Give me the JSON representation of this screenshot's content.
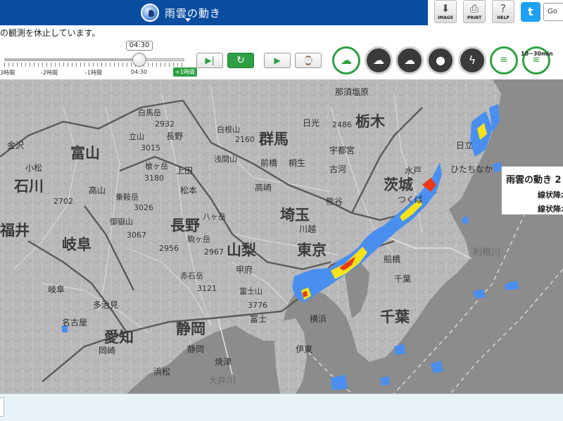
{
  "header": {
    "app_title": "雨雲の動き",
    "buttons": {
      "image": "IMAGE",
      "print": "PRINT",
      "help": "HELP",
      "twitter": "t",
      "google": "Go"
    }
  },
  "notice": "の観測を休止しています。",
  "slider": {
    "current_time": "04:30",
    "tick_labels": [
      "3時間",
      "-2時間",
      "-1時間",
      "04:30"
    ],
    "plus_label": "+1時間",
    "position_fraction": 0.75
  },
  "playback": {
    "step": "▶|",
    "latest": "↻",
    "play": "▶",
    "speed": "⌚"
  },
  "layers": {
    "line_b_label": "10~30min"
  },
  "map": {
    "prefectures": [
      "栃木",
      "群馬",
      "茨城",
      "埼玉",
      "長野",
      "山梨",
      "東京",
      "富山",
      "石川",
      "福井",
      "岐阜",
      "愛知",
      "静岡",
      "千葉"
    ],
    "cities": [
      "那須塩原",
      "日光",
      "宇都宮",
      "前橋",
      "桐生",
      "高崎",
      "水戸",
      "つくば",
      "熊谷",
      "川越",
      "甲府",
      "富士",
      "横浜",
      "船橋",
      "千葉",
      "長野",
      "松本",
      "上田",
      "高山",
      "金沢",
      "小松",
      "岐阜",
      "名古屋",
      "岡崎",
      "浜松",
      "静岡",
      "焼津",
      "伊東",
      "多治見",
      "利根川",
      "大井川",
      "白根山",
      "浅間山",
      "日立",
      "ひたちなか",
      "古河",
      "白馬岳",
      "立山",
      "槍ヶ岳",
      "乗鞍岳",
      "御嶽山",
      "駒ヶ岳",
      "八ヶ岳",
      "赤石岳",
      "富士山"
    ],
    "marks": [
      "2932",
      "3015",
      "3180",
      "3026",
      "3067",
      "2956",
      "2967",
      "3121",
      "2160",
      "2486",
      "2702",
      "3776"
    ]
  },
  "info_panel": {
    "title": "雨雲の動き 2",
    "line1": "線状降水",
    "line2": "線状降水"
  },
  "colors": {
    "header": "#0a4ea0",
    "accent": "#2ea043",
    "map_bg": "#bdbdbd",
    "rain_light": "#4a8ff0",
    "rain_mid": "#f5e21a",
    "rain_heavy": "#e83a1a"
  }
}
